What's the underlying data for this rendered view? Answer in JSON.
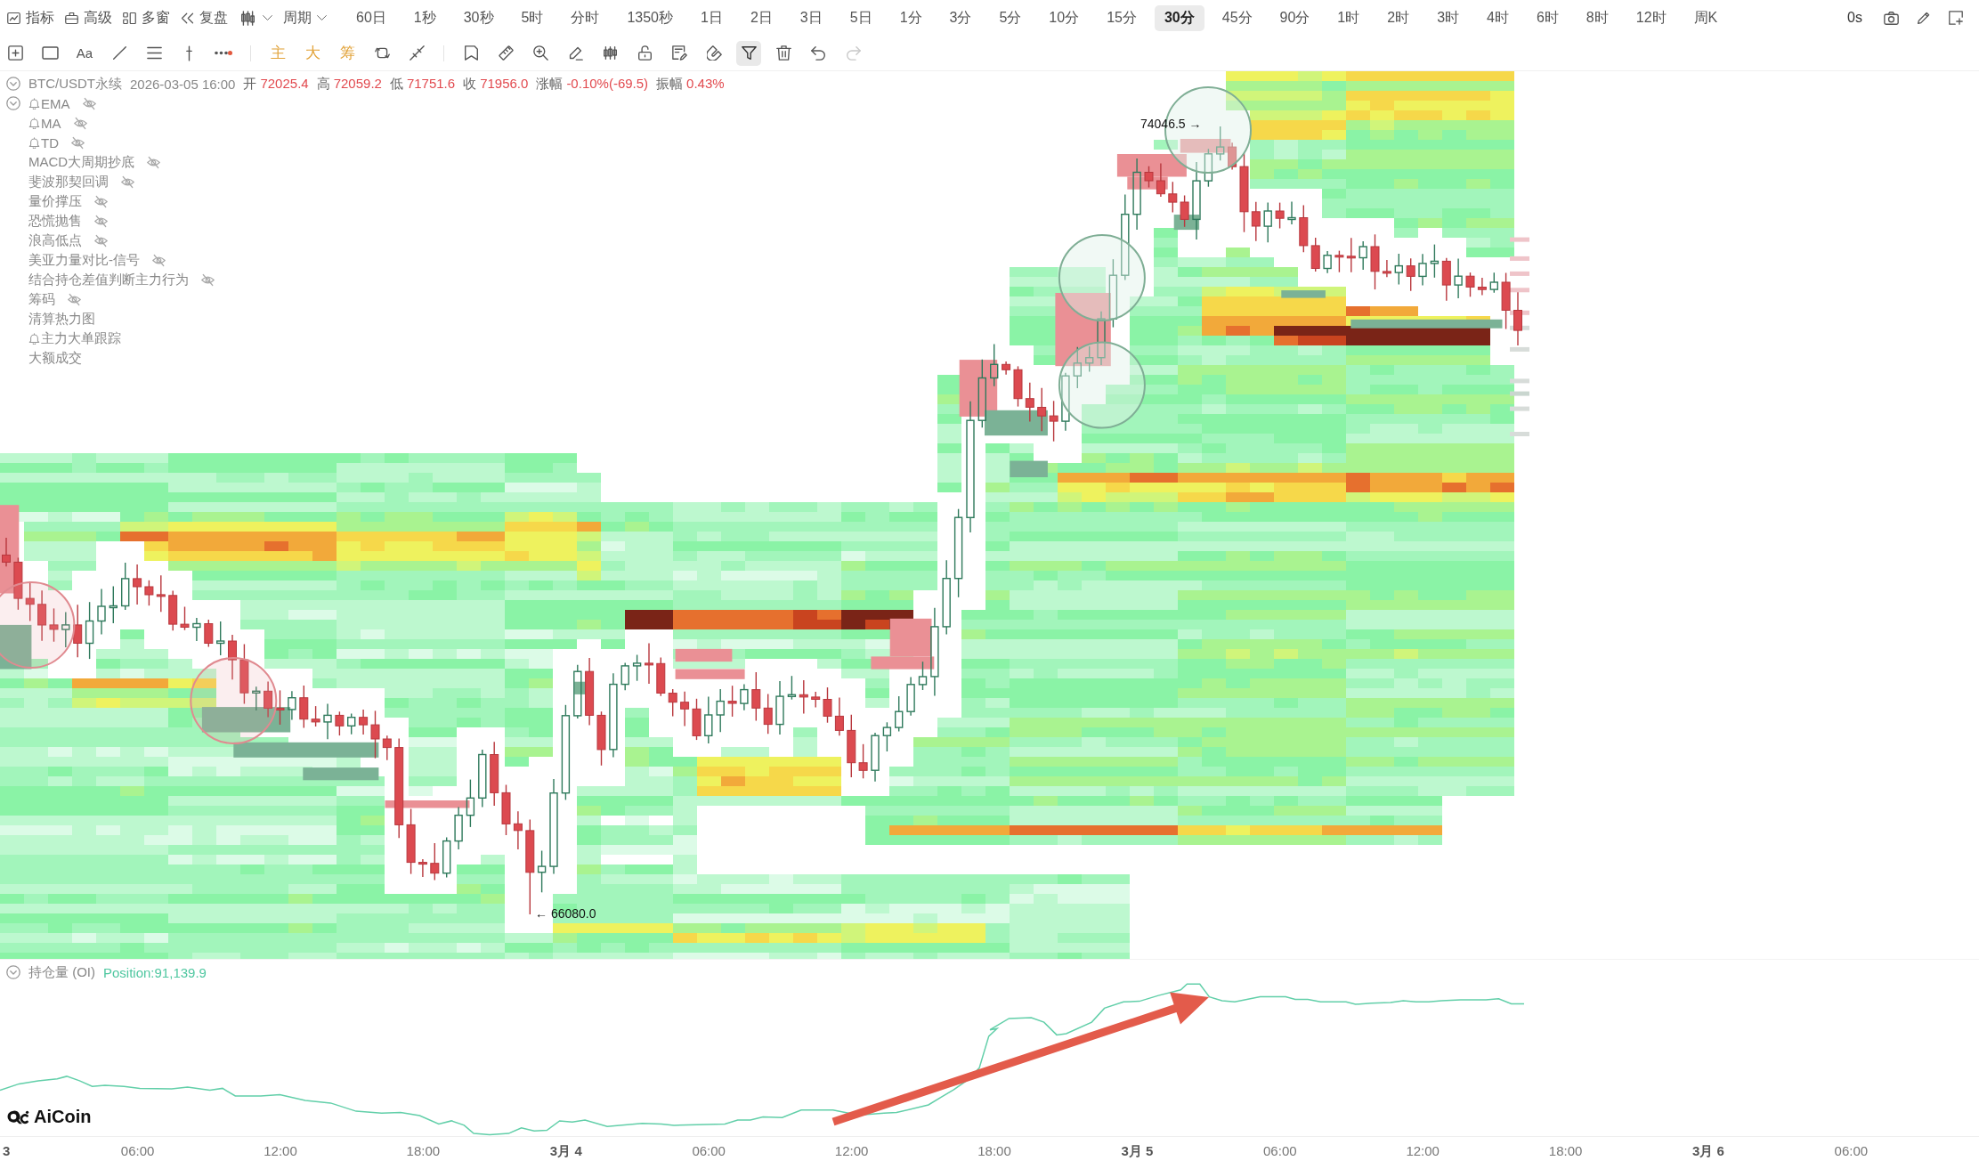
{
  "top_bar": {
    "menu": [
      {
        "label": "指标"
      },
      {
        "label": "高级"
      },
      {
        "label": "多窗"
      },
      {
        "label": "复盘"
      }
    ],
    "period": {
      "label": "周期"
    },
    "intervals": [
      {
        "label": "60日",
        "selected": false
      },
      {
        "label": "1秒",
        "selected": false
      },
      {
        "label": "30秒",
        "selected": false
      },
      {
        "label": "5时",
        "selected": false
      },
      {
        "label": "分时",
        "selected": false
      },
      {
        "label": "1350秒",
        "selected": false
      },
      {
        "label": "1日",
        "selected": false
      },
      {
        "label": "2日",
        "selected": false
      },
      {
        "label": "3日",
        "selected": false
      },
      {
        "label": "5日",
        "selected": false
      },
      {
        "label": "1分",
        "selected": false
      },
      {
        "label": "3分",
        "selected": false
      },
      {
        "label": "5分",
        "selected": false
      },
      {
        "label": "10分",
        "selected": false
      },
      {
        "label": "15分",
        "selected": false
      },
      {
        "label": "30分",
        "selected": true
      },
      {
        "label": "45分",
        "selected": false
      },
      {
        "label": "90分",
        "selected": false
      },
      {
        "label": "1时",
        "selected": false
      },
      {
        "label": "2时",
        "selected": false
      },
      {
        "label": "3时",
        "selected": false
      },
      {
        "label": "4时",
        "selected": false
      },
      {
        "label": "6时",
        "selected": false
      },
      {
        "label": "8时",
        "selected": false
      },
      {
        "label": "12时",
        "selected": false
      },
      {
        "label": "周K",
        "selected": false
      }
    ],
    "timer": "0s"
  },
  "drawing_toolbar": {
    "groups": [
      [
        {
          "kind": "icon",
          "selected": false,
          "disabled": false
        },
        {
          "kind": "icon",
          "selected": false,
          "disabled": false
        },
        {
          "kind": "text",
          "label": "Aa",
          "selected": false,
          "disabled": false
        },
        {
          "kind": "icon",
          "selected": false,
          "disabled": false
        },
        {
          "kind": "icon",
          "selected": false,
          "disabled": false
        },
        {
          "kind": "icon",
          "selected": false,
          "disabled": false
        },
        {
          "kind": "icon",
          "selected": false,
          "disabled": false
        }
      ],
      [
        {
          "kind": "quick",
          "label": "主",
          "selected": false,
          "disabled": false
        },
        {
          "kind": "quick",
          "label": "大",
          "selected": false,
          "disabled": false
        },
        {
          "kind": "quick",
          "label": "筹",
          "selected": false,
          "disabled": false
        },
        {
          "kind": "icon",
          "selected": false,
          "disabled": false
        },
        {
          "kind": "icon",
          "selected": false,
          "disabled": false
        }
      ],
      [
        {
          "kind": "icon",
          "selected": false,
          "disabled": false
        },
        {
          "kind": "icon",
          "selected": false,
          "disabled": false
        },
        {
          "kind": "icon",
          "selected": false,
          "disabled": false
        },
        {
          "kind": "icon",
          "selected": false,
          "disabled": false
        },
        {
          "kind": "icon",
          "selected": false,
          "disabled": false
        },
        {
          "kind": "icon",
          "selected": false,
          "disabled": false
        },
        {
          "kind": "icon",
          "selected": false,
          "disabled": false
        },
        {
          "kind": "icon",
          "selected": false,
          "disabled": false
        },
        {
          "kind": "icon",
          "selected": true,
          "disabled": false
        },
        {
          "kind": "icon",
          "selected": false,
          "disabled": false
        },
        {
          "kind": "icon",
          "selected": false,
          "disabled": false
        },
        {
          "kind": "icon",
          "selected": false,
          "disabled": true
        }
      ]
    ]
  },
  "legend": {
    "expanded": true,
    "symbol": "BTC/USDT永续",
    "time": "2026-03-05 16:00",
    "fields": [
      {
        "label": "开",
        "value": "72025.4"
      },
      {
        "label": "高",
        "value": "72059.2"
      },
      {
        "label": "低",
        "value": "71751.6"
      },
      {
        "label": "收",
        "value": "71956.0"
      },
      {
        "label": "涨幅",
        "value": "-0.10%(-69.5)"
      },
      {
        "label": "振幅",
        "value": "0.43%"
      }
    ]
  },
  "indicators": {
    "expanded": true,
    "items": [
      {
        "name": "EMA",
        "alert": true,
        "hidden": true
      },
      {
        "name": "MA",
        "alert": true,
        "hidden": true
      },
      {
        "name": "TD",
        "alert": true,
        "hidden": true
      },
      {
        "name": "MACD大周期抄底",
        "alert": false,
        "hidden": true
      },
      {
        "name": "斐波那契回调",
        "alert": false,
        "hidden": true
      },
      {
        "name": "量价撑压",
        "alert": false,
        "hidden": true
      },
      {
        "name": "恐慌抛售",
        "alert": false,
        "hidden": true
      },
      {
        "name": "浪高低点",
        "alert": false,
        "hidden": true
      },
      {
        "name": "美亚力量对比-信号",
        "alert": false,
        "hidden": true
      },
      {
        "name": "结合持仓差值判断主力行为",
        "alert": false,
        "hidden": true
      },
      {
        "name": "筹码",
        "alert": false,
        "hidden": true
      },
      {
        "name": "清算热力图",
        "alert": false,
        "hidden": false
      },
      {
        "name": "主力大单跟踪",
        "alert": true,
        "hidden": false
      },
      {
        "name": "大额成交",
        "alert": false,
        "hidden": false
      }
    ]
  },
  "chart": {
    "high_label": "74046.5 →",
    "low_label": "← 66080.0"
  },
  "oi_panel": {
    "expanded": true,
    "title": "持仓量 (OI)",
    "value": "Position:91,139.9"
  },
  "logo": {
    "text": "AiCoin"
  },
  "time_axis": {
    "labels": [
      {
        "kind": "date",
        "label": "3"
      },
      {
        "kind": "time",
        "label": "06:00"
      },
      {
        "kind": "time",
        "label": "12:00"
      },
      {
        "kind": "time",
        "label": "18:00"
      },
      {
        "kind": "date",
        "label": "3月 4"
      },
      {
        "kind": "time",
        "label": "06:00"
      },
      {
        "kind": "time",
        "label": "12:00"
      },
      {
        "kind": "time",
        "label": "18:00"
      },
      {
        "kind": "date",
        "label": "3月 5"
      },
      {
        "kind": "time",
        "label": "06:00"
      },
      {
        "kind": "time",
        "label": "12:00"
      },
      {
        "kind": "time",
        "label": "18:00"
      },
      {
        "kind": "date",
        "label": "3月 6"
      },
      {
        "kind": "time",
        "label": "06:00"
      }
    ]
  }
}
